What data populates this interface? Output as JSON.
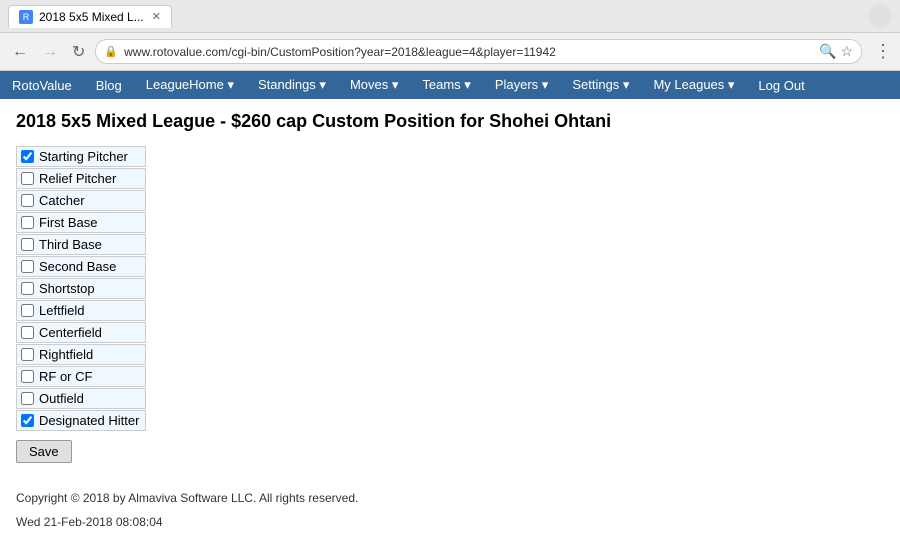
{
  "browser": {
    "tab_title": "2018 5x5 Mixed L...",
    "url": "www.rotovalue.com/cgi-bin/CustomPosition?year=2018&league=4&player=11942",
    "user_icon": "👤"
  },
  "nav": {
    "items": [
      {
        "label": "RotoValue",
        "has_dropdown": false
      },
      {
        "label": "Blog",
        "has_dropdown": false
      },
      {
        "label": "LeagueHome",
        "has_dropdown": true
      },
      {
        "label": "Standings",
        "has_dropdown": true
      },
      {
        "label": "Moves",
        "has_dropdown": true
      },
      {
        "label": "Teams",
        "has_dropdown": true
      },
      {
        "label": "Players",
        "has_dropdown": true
      },
      {
        "label": "Settings",
        "has_dropdown": true
      },
      {
        "label": "My Leagues",
        "has_dropdown": true
      },
      {
        "label": "Log Out",
        "has_dropdown": false
      }
    ]
  },
  "page": {
    "title": "2018 5x5 Mixed League - $260 cap Custom Position for Shohei Ohtani",
    "positions": [
      {
        "label": "Starting Pitcher",
        "checked": true
      },
      {
        "label": "Relief Pitcher",
        "checked": false
      },
      {
        "label": "Catcher",
        "checked": false
      },
      {
        "label": "First Base",
        "checked": false
      },
      {
        "label": "Third Base",
        "checked": false
      },
      {
        "label": "Second Base",
        "checked": false
      },
      {
        "label": "Shortstop",
        "checked": false
      },
      {
        "label": "Leftfield",
        "checked": false
      },
      {
        "label": "Centerfield",
        "checked": false
      },
      {
        "label": "Rightfield",
        "checked": false
      },
      {
        "label": "RF or CF",
        "checked": false
      },
      {
        "label": "Outfield",
        "checked": false
      },
      {
        "label": "Designated Hitter",
        "checked": true
      }
    ],
    "save_button": "Save"
  },
  "footer": {
    "copyright": "Copyright © 2018 by Almaviva Software LLC. All rights reserved.",
    "timestamp": "Wed 21-Feb-2018 08:08:04"
  }
}
